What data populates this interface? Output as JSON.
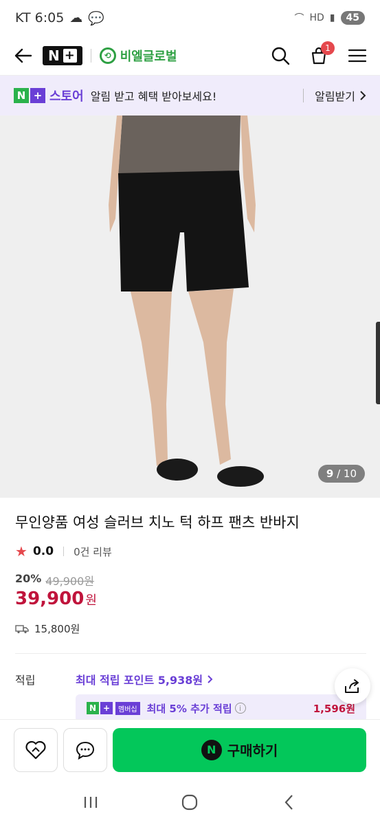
{
  "status_bar": {
    "carrier_time": "KT 6:05",
    "battery": "45"
  },
  "header": {
    "logo_text": "N",
    "brand_name": "비엘글로벌",
    "cart_count": "1"
  },
  "notification": {
    "store_label": "스토어",
    "message": "알림 받고 혜택 받아보세요!",
    "cta": "알림받기"
  },
  "image_counter": {
    "current": "9",
    "total": "/ 10"
  },
  "product": {
    "title": "무인양품 여성 슬러브 치노 턱 하프 팬츠 반바지",
    "rating": "0.0",
    "review_count": "0건 리뷰",
    "discount": "20%",
    "original_price": "49,900원",
    "price": "39,900",
    "price_unit": "원",
    "shipping": "15,800원"
  },
  "points": {
    "label": "적립",
    "max_points": "최대 적립 포인트 5,938원",
    "membership_tag": "멤버십",
    "membership_text": "최대 5% 추가 적립",
    "membership_amount": "1,596원"
  },
  "bottom_bar": {
    "buy_label": "구매하기",
    "buy_icon": "N"
  },
  "colors": {
    "accent_purple": "#6a3fd6",
    "naver_green": "#03c75a",
    "price_red": "#c0143c"
  }
}
